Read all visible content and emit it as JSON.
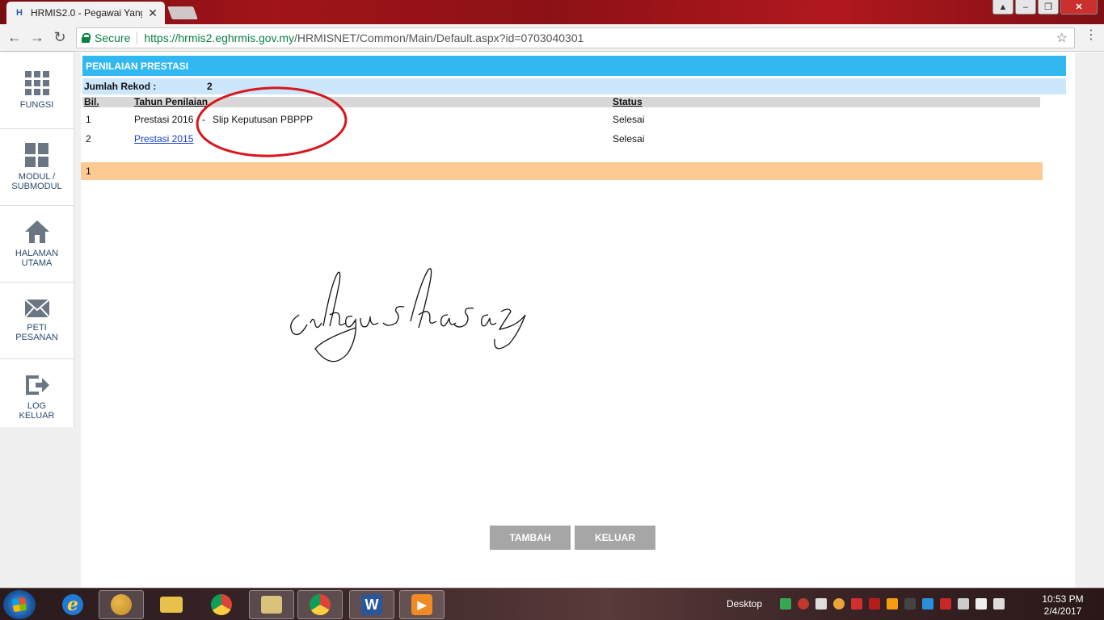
{
  "browser": {
    "tab_title": "HRMIS2.0 - Pegawai Yang",
    "tab_favicon": "H",
    "close_glyph": "✕",
    "secure_label": "Secure",
    "url_host": "https://hrmis2.eghrmis.gov.my",
    "url_path": "/HRMISNET/Common/Main/Default.aspx?id=0703040301"
  },
  "sidebar": {
    "items": [
      {
        "label1": "FUNGSI",
        "label2": ""
      },
      {
        "label1": "MODUL /",
        "label2": "SUBMODUL"
      },
      {
        "label1": "HALAMAN",
        "label2": "UTAMA"
      },
      {
        "label1": "PETI",
        "label2": "PESANAN"
      },
      {
        "label1": "LOG",
        "label2": "KELUAR"
      }
    ]
  },
  "main": {
    "section_title": "PENILAIAN PRESTASI",
    "record_label": "Jumlah Rekod :",
    "record_count": "2",
    "columns": {
      "bil": "Bil.",
      "tahun": "Tahun Penilaian",
      "status": "Status"
    },
    "rows": [
      {
        "bil": "1",
        "tahun": "Prestasi 2016",
        "sep": "-",
        "slip": "Slip Keputusan PBPPP",
        "status": "Selesai"
      },
      {
        "bil": "2",
        "tahun": "Prestasi 2015",
        "status": "Selesai"
      }
    ],
    "pager": "1",
    "signature": "cikgu shasaz",
    "buttons": {
      "tambah": "TAMBAH",
      "keluar": "KELUAR"
    }
  },
  "taskbar": {
    "desktop": "Desktop",
    "time": "10:53 PM",
    "date": "2/4/2017",
    "word_label": "W"
  }
}
